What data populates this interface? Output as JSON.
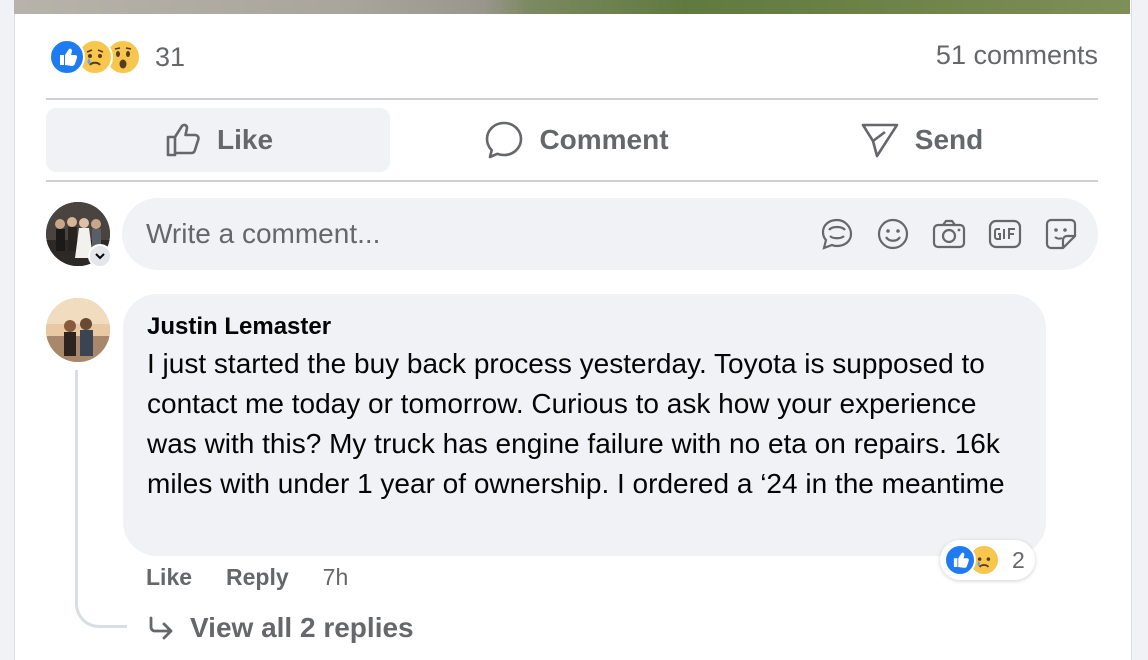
{
  "post": {
    "reaction_count": "31",
    "reactions": [
      "like",
      "sad",
      "wow"
    ],
    "comments_count": "51 comments"
  },
  "actions": {
    "like": "Like",
    "comment": "Comment",
    "send": "Send"
  },
  "composer": {
    "placeholder": "Write a comment...",
    "icons": [
      "avatar-sticker-icon",
      "emoji-icon",
      "camera-icon",
      "gif-icon",
      "sticker-icon"
    ]
  },
  "comment": {
    "author": "Justin Lemaster",
    "text": "I just started the buy back process yesterday. Toyota is supposed to contact me today or tomorrow. Curious to ask how your experience was with this? My truck has engine failure with no eta on repairs. 16k miles with under 1 year of ownership. I ordered a ‘24 in the meantime",
    "like_label": "Like",
    "reply_label": "Reply",
    "time": "7h",
    "reaction_count": "2",
    "reactions": [
      "like",
      "sad"
    ],
    "view_replies": "View all 2 replies"
  },
  "colors": {
    "accent": "#1f7bf2",
    "secondary_text": "#65676b",
    "bubble_bg": "#f0f2f5"
  }
}
